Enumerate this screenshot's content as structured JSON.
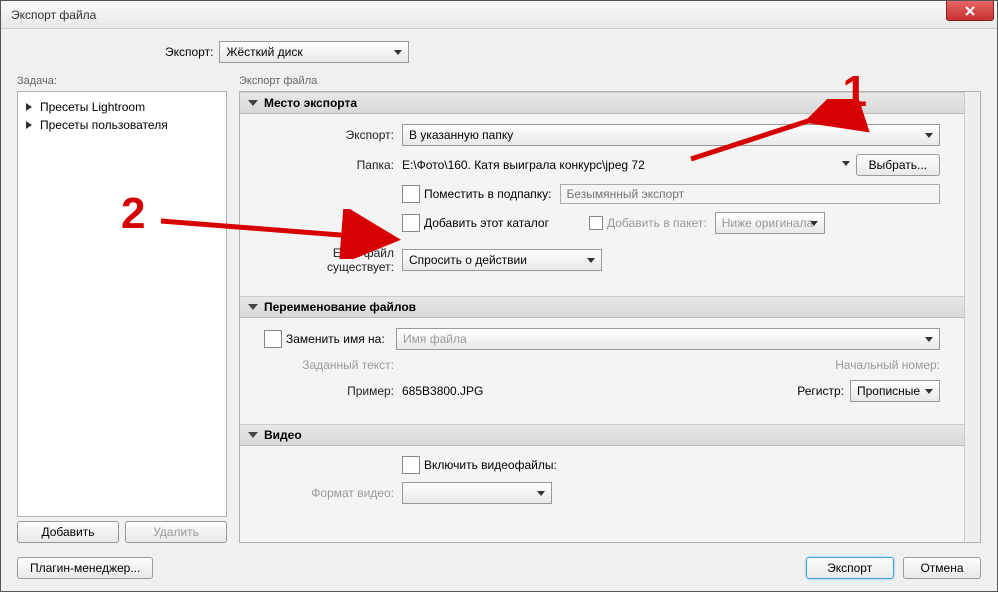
{
  "window": {
    "title": "Экспорт файла"
  },
  "export_label": "Экспорт:",
  "export_target": "Жёсткий диск",
  "left": {
    "section": "Задача:",
    "presets": [
      "Пресеты Lightroom",
      "Пресеты пользователя"
    ],
    "add": "Добавить",
    "remove": "Удалить"
  },
  "right_section": "Экспорт файла",
  "panels": {
    "location": {
      "title": "Место экспорта",
      "export_label": "Экспорт:",
      "export_value": "В указанную папку",
      "folder_label": "Папка:",
      "folder_value": "E:\\Фото\\160. Катя выиграла конкурс\\jpeg 72",
      "choose": "Выбрать...",
      "subfolder_cb": "Поместить в подпапку:",
      "subfolder_placeholder": "Безымянный экспорт",
      "add_catalog": "Добавить этот каталог",
      "add_packet": "Добавить в пакет:",
      "packet_value": "Ниже оригинала",
      "exists_label": "Если файл существует:",
      "exists_value": "Спросить о действии"
    },
    "rename": {
      "title": "Переименование файлов",
      "rename_cb": "Заменить имя на:",
      "rename_placeholder": "Имя файла",
      "custom_text": "Заданный текст:",
      "start_num": "Начальный номер:",
      "example_label": "Пример:",
      "example_value": "685B3800.JPG",
      "case_label": "Регистр:",
      "case_value": "Прописные"
    },
    "video": {
      "title": "Видео",
      "include": "Включить видеофайлы:",
      "format_label": "Формат видео:"
    }
  },
  "footer": {
    "plugin": "Плагин-менеджер...",
    "export": "Экспорт",
    "cancel": "Отмена"
  },
  "annotations": {
    "n1": "1",
    "n2": "2"
  }
}
